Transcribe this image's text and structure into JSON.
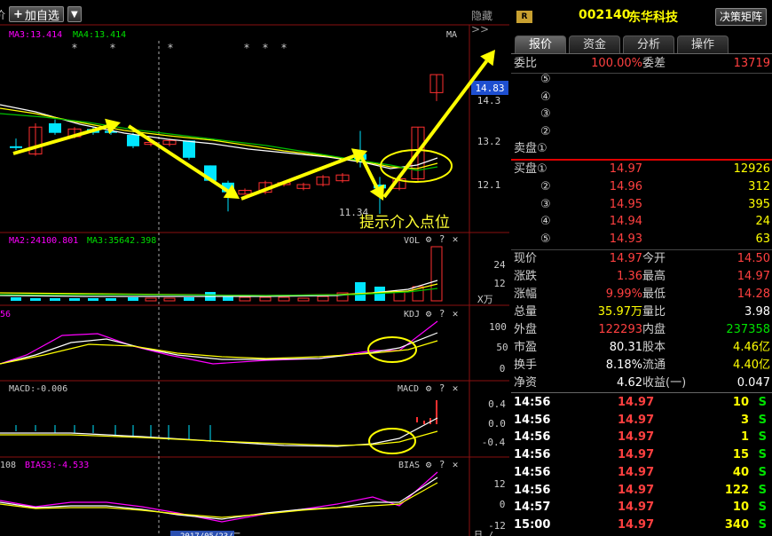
{
  "toolbar": {
    "left_cut": "价",
    "add_watchlist": "加自选",
    "dropdown": "▼",
    "hide_label": "隐藏>>"
  },
  "indicators": {
    "main": {
      "ma3": "MA3:13.414",
      "ma4": "MA4:13.414",
      "right": "MA"
    },
    "vol": {
      "ma2": "MA2:24100.801",
      "ma3": "MA3:35642.398",
      "name": "VOL",
      "unit": "X万"
    },
    "kdj": {
      "left": "56",
      "name": "KDJ"
    },
    "macd": {
      "left": "MACD:-0.006",
      "name": "MACD"
    },
    "bias": {
      "left": "108",
      "bias3": "BIAS3:-4.533",
      "name": "BIAS"
    }
  },
  "axis": {
    "main": [
      "14.3",
      "13.2",
      "12.1"
    ],
    "current_price": "14.83",
    "vol": [
      "24",
      "12"
    ],
    "kdj": [
      "100",
      "50",
      "0"
    ],
    "macd": [
      "0.4",
      "0.0",
      "-0.4"
    ],
    "bias": [
      "12",
      "0",
      "-12"
    ]
  },
  "chart_labels": {
    "low_price": "11.34",
    "annotation": "提示介入点位",
    "date_cut": "2017/05/23/二",
    "bottom_right": "日 /"
  },
  "colors": {
    "up": "#ff3030",
    "down": "#00e5ff",
    "ma_white": "#ffffff",
    "ma_yellow": "#ffff00",
    "ma_green": "#00c000",
    "magenta": "#ff00ff",
    "arrow": "#ffff00"
  },
  "stock": {
    "badge": "R",
    "code": "002140",
    "name": "东华科技",
    "decision": "决策矩阵"
  },
  "tabs": [
    "报价",
    "资金",
    "分析",
    "操作"
  ],
  "committee": {
    "ratio_label": "委比",
    "ratio": "100.00%",
    "diff_label": "委差",
    "diff": "13719"
  },
  "sell": [
    {
      "label": "⑤",
      "price": "",
      "vol": ""
    },
    {
      "label": "④",
      "price": "",
      "vol": ""
    },
    {
      "label": "③",
      "price": "",
      "vol": ""
    },
    {
      "label": "②",
      "price": "",
      "vol": ""
    },
    {
      "label": "卖盘①",
      "price": "",
      "vol": ""
    }
  ],
  "buy": [
    {
      "label": "买盘①",
      "price": "14.97",
      "vol": "12926"
    },
    {
      "label": "②",
      "price": "14.96",
      "vol": "312"
    },
    {
      "label": "③",
      "price": "14.95",
      "vol": "395"
    },
    {
      "label": "④",
      "price": "14.94",
      "vol": "24"
    },
    {
      "label": "⑤",
      "price": "14.93",
      "vol": "63"
    }
  ],
  "stats": [
    {
      "l1": "现价",
      "v1": "14.97",
      "l2": "今开",
      "v2": "14.50"
    },
    {
      "l1": "涨跌",
      "v1": "1.36",
      "l2": "最高",
      "v2": "14.97"
    },
    {
      "l1": "涨幅",
      "v1": "9.99%",
      "l2": "最低",
      "v2": "14.28"
    },
    {
      "l1": "总量",
      "v1": "35.97万",
      "l2": "量比",
      "v2": "3.98"
    },
    {
      "l1": "外盘",
      "v1": "122293",
      "l2": "内盘",
      "v2": "237358"
    },
    {
      "l1": "市盈",
      "v1": "80.31",
      "l2": "股本",
      "v2": "4.46亿"
    },
    {
      "l1": "换手",
      "v1": "8.18%",
      "l2": "流通",
      "v2": "4.40亿"
    },
    {
      "l1": "净资",
      "v1": "4.62",
      "l2": "收益(一)",
      "v2": "0.047"
    }
  ],
  "ticks": [
    {
      "time": "14:56",
      "price": "14.97",
      "vol": "10",
      "side": "S"
    },
    {
      "time": "14:56",
      "price": "14.97",
      "vol": "3",
      "side": "S"
    },
    {
      "time": "14:56",
      "price": "14.97",
      "vol": "1",
      "side": "S"
    },
    {
      "time": "14:56",
      "price": "14.97",
      "vol": "15",
      "side": "S"
    },
    {
      "time": "14:56",
      "price": "14.97",
      "vol": "40",
      "side": "S"
    },
    {
      "time": "14:56",
      "price": "14.97",
      "vol": "122",
      "side": "S"
    },
    {
      "time": "14:57",
      "price": "14.97",
      "vol": "10",
      "side": "S"
    },
    {
      "time": "15:00",
      "price": "14.97",
      "vol": "340",
      "side": "S"
    }
  ]
}
